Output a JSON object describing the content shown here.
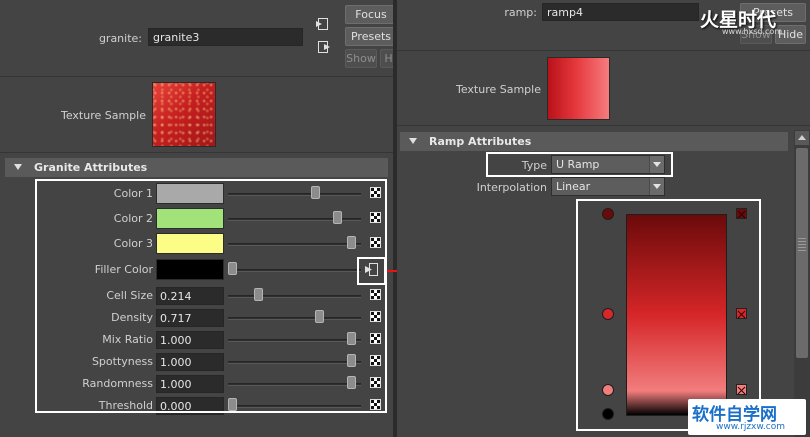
{
  "left": {
    "name_label": "granite:",
    "name_value": "granite3",
    "buttons": {
      "focus": "Focus",
      "presets": "Presets",
      "show": "Show",
      "hide": "H"
    },
    "texture_sample_label": "Texture Sample",
    "section_title": "Granite Attributes",
    "attributes": [
      {
        "label": "Color 1",
        "kind": "color",
        "color": "#a9a9a9",
        "slider": 0.67
      },
      {
        "label": "Color 2",
        "kind": "color",
        "color": "#a2e27a",
        "slider": 0.85
      },
      {
        "label": "Color 3",
        "kind": "color",
        "color": "#fbfd86",
        "slider": 0.96
      },
      {
        "label": "Filler Color",
        "kind": "color",
        "color": "#000000",
        "slider": 0.0
      },
      {
        "label": "Cell Size",
        "kind": "number",
        "value": "0.214",
        "slider": 0.21
      },
      {
        "label": "Density",
        "kind": "number",
        "value": "0.717",
        "slider": 0.7
      },
      {
        "label": "Mix Ratio",
        "kind": "number",
        "value": "1.000",
        "slider": 0.96
      },
      {
        "label": "Spottyness",
        "kind": "number",
        "value": "1.000",
        "slider": 0.96
      },
      {
        "label": "Randomness",
        "kind": "number",
        "value": "1.000",
        "slider": 0.96
      },
      {
        "label": "Threshold",
        "kind": "number",
        "value": "0.000",
        "slider": 0.0
      }
    ]
  },
  "right": {
    "name_label": "ramp:",
    "name_value": "ramp4",
    "buttons": {
      "presets": "Presets",
      "show": "Show",
      "hide": "Hide"
    },
    "texture_sample_label": "Texture Sample",
    "section_title": "Ramp Attributes",
    "type_label": "Type",
    "type_value": "U Ramp",
    "interpolation_label": "Interpolation",
    "interpolation_value": "Linear",
    "ramp_markers": [
      {
        "position": 1.0,
        "color": "#6b0a0a"
      },
      {
        "position": 0.5,
        "color": "#d6282a"
      },
      {
        "position": 0.12,
        "color": "#f27d7d"
      },
      {
        "position": 0.0,
        "color": "#000000"
      }
    ]
  },
  "colors": {
    "panel_bg": "#444444",
    "highlight_outline": "#ffffff",
    "arrow": "#ee1111"
  },
  "watermark_top": "火星时代",
  "watermark_top_sub": "www.hxsd.com",
  "watermark_bottom": "软件自学网",
  "watermark_bottom_sub": "www.rjzxw.com"
}
